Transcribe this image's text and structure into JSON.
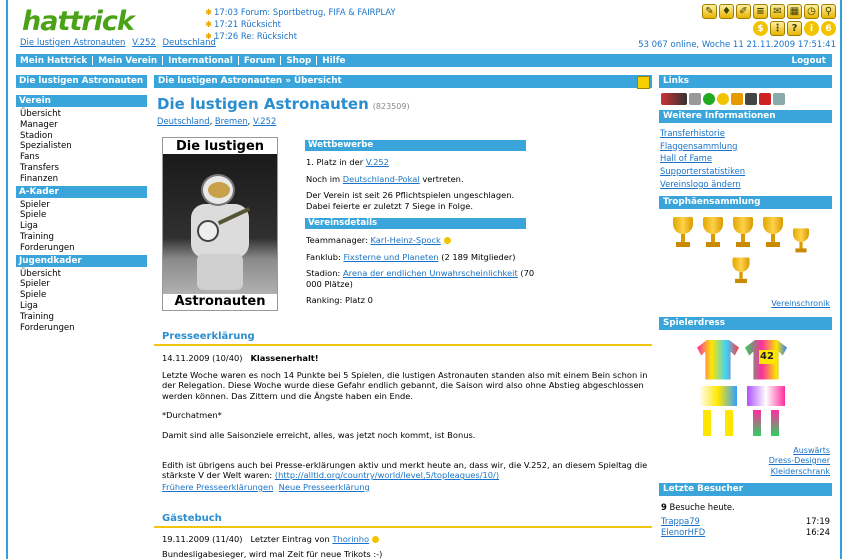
{
  "header": {
    "logo": "hattrick",
    "team_link": "Die lustigen Astronauten",
    "league_link": "V.252",
    "country_link": "Deutschland",
    "news": [
      {
        "time": "17:03",
        "text": "Forum: Sportbetrug, FIFA & FAIRPLAY"
      },
      {
        "time": "17:21",
        "text": "Rücksicht"
      },
      {
        "time": "17:26",
        "text": "Re: Rücksicht"
      }
    ],
    "online": "53 067 online, Woche 11 21.11.2009 17:51:41"
  },
  "nav": {
    "items": [
      "Mein Hattrick",
      "Mein Verein",
      "International",
      "Forum",
      "Shop",
      "Hilfe"
    ],
    "logout": "Logout"
  },
  "left": {
    "title": "Die lustigen Astronauten",
    "verein_header": "Verein",
    "verein": [
      "Übersicht",
      "Manager",
      "Stadion",
      "Spezialisten",
      "Fans",
      "Transfers",
      "Finanzen"
    ],
    "akader_header": "A-Kader",
    "akader": [
      "Spieler",
      "Spiele",
      "Liga",
      "Training",
      "Forderungen"
    ],
    "jugend_header": "Jugendkader",
    "jugend": [
      "Übersicht",
      "Spieler",
      "Spiele",
      "Liga",
      "Training",
      "Forderungen"
    ]
  },
  "center": {
    "breadcrumb": "Die lustigen Astronauten » Übersicht",
    "title": "Die lustigen Astronauten",
    "team_id": "(823509)",
    "location": [
      "Deutschland",
      "Bremen",
      "V.252"
    ],
    "logo_top": "Die lustigen",
    "logo_bottom": "Astronauten",
    "wettbewerbe_header": "Wettbewerbe",
    "place_prefix": "1. Platz in der",
    "place_league": "V.252",
    "pokal_prefix": "Noch im",
    "pokal_link": "Deutschland-Pokal",
    "pokal_suffix": "vertreten.",
    "streak": "Der Verein ist seit 26 Pflichtspielen ungeschlagen. Dabei feierte er zuletzt 7 Siege in Folge.",
    "details_header": "Vereinsdetails",
    "manager_label": "Teammanager:",
    "manager": "Karl-Heinz-Spock",
    "fanclub_label": "Fanklub:",
    "fanclub": "Fixsterne und Planeten",
    "fanclub_members": "(2 189 Mitglieder)",
    "stadium_label": "Stadion:",
    "stadium": "Arena der endlichen Unwahrscheinlichkeit",
    "stadium_seats": "(70 000 Plätze)",
    "ranking": "Ranking: Platz 0",
    "press_header": "Presseerklärung",
    "press_date": "14.11.2009 (10/40)",
    "press_title": "Klassenerhalt!",
    "press_p1": "Letzte Woche waren es noch 14 Punkte bei 5 Spielen, die lustigen Astronauten standen also mit einem Bein schon in der Relegation. Diese Woche wurde diese Gefahr endlich gebannt, die Saison wird also ohne Abstieg abgeschlossen werden können. Das Zittern und die Ängste haben ein Ende.",
    "press_p2": "*Durchatmen*",
    "press_p3": "Damit sind alle Saisonziele erreicht, alles, was jetzt noch kommt, ist Bonus.",
    "press_p4": "Edith ist übrigens auch bei Presse-erklärungen aktiv und merkt heute an, dass wir, die V.252, an diesem Spieltag die stärkste V der Welt waren:",
    "press_url": "(http://alltid.org/country/world/level,5/topleagues/10/)",
    "press_prev": "Frühere Presseerklärungen",
    "press_new": "Neue Presseerklärung",
    "guest_header": "Gästebuch",
    "guest_date": "19.11.2009 (11/40)",
    "guest_label": "Letzter Eintrag von",
    "guest_user": "Thorinho",
    "guest_text": "Bundesligabesieger, wird mal Zeit für neue Trikots :-)"
  },
  "right": {
    "links_header": "Links",
    "info_header": "Weitere Informationen",
    "info_links": [
      "Transferhistorie",
      "Flaggensammlung",
      "Hall of Fame",
      "Supporterstatistiken",
      "Vereinslogo ändern"
    ],
    "trophy_header": "Trophäensammlung",
    "chronik": "Vereinschronik",
    "kit_header": "Spielerdress",
    "shirt_number": "42",
    "kit_links": [
      "Auswärts",
      "Dress-Designer",
      "Kleiderschrank"
    ],
    "visitors_header": "Letzte Besucher",
    "visits_count": "9",
    "visits_label": "Besuche heute.",
    "visitors": [
      {
        "name": "Trappa79",
        "time": "17:19"
      },
      {
        "name": "ElenorHFD",
        "time": "16:24"
      }
    ]
  }
}
